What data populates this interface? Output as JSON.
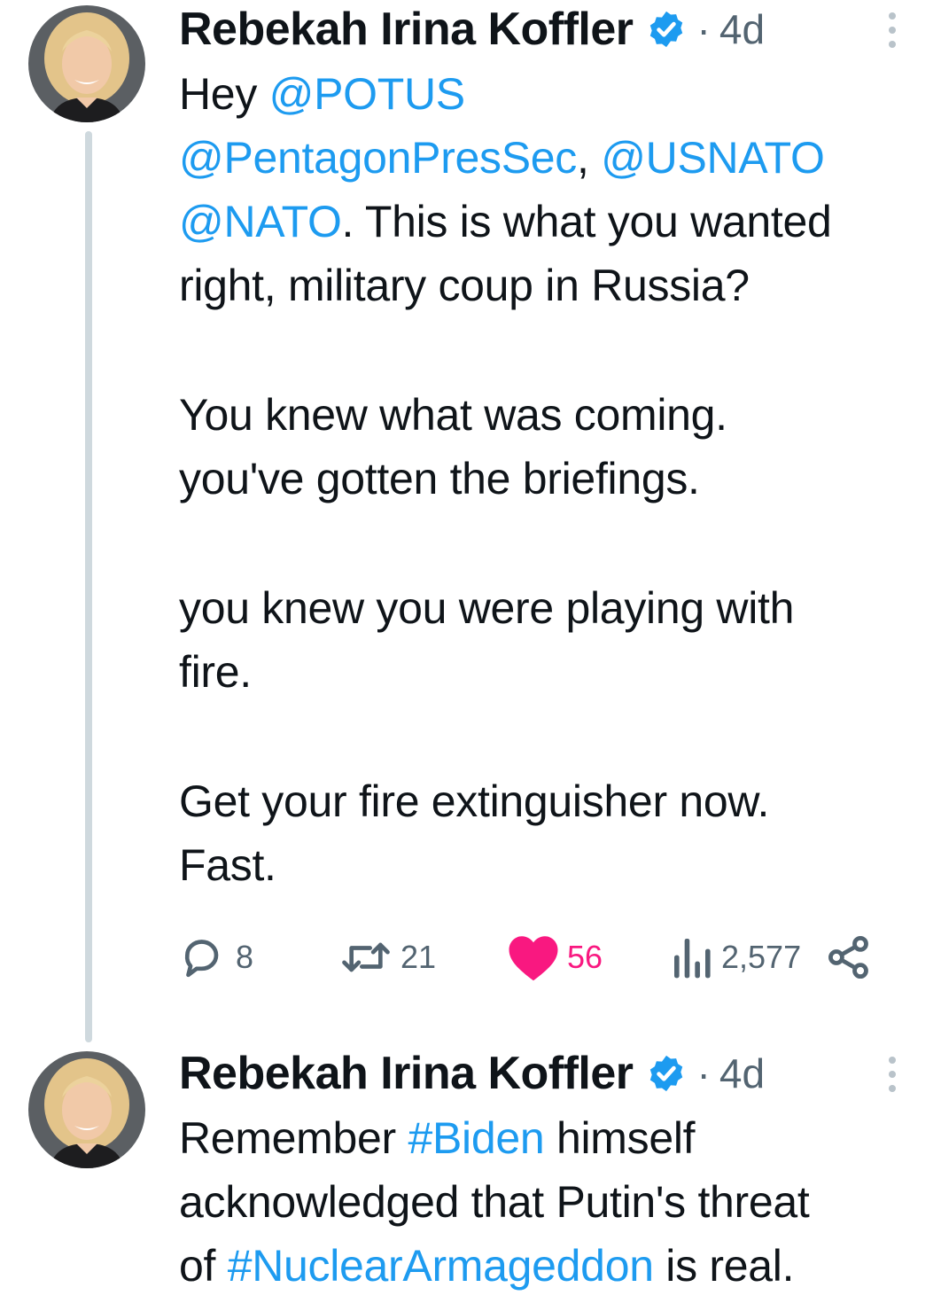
{
  "colors": {
    "link": "#1d9bf0",
    "text": "#0f1419",
    "muted": "#536471",
    "like": "#f91880",
    "verified": "#1d9bf0",
    "thread_line": "#cfd9de"
  },
  "tweets": [
    {
      "author": "Rebekah Irina Koffler",
      "verified": true,
      "separator": "·",
      "time": "4d",
      "lines": [
        [
          {
            "t": "Hey "
          },
          {
            "t": "@POTUS",
            "link": true
          }
        ],
        [
          {
            "t": "@PentagonPresSec",
            "link": true
          },
          {
            "t": ", "
          },
          {
            "t": "@USNATO",
            "link": true
          }
        ],
        [
          {
            "t": "@NATO",
            "link": true
          },
          {
            "t": ". This is what you wanted"
          }
        ],
        [
          {
            "t": "right, military coup in Russia?"
          }
        ],
        null,
        [
          {
            "t": "You knew what was coming."
          }
        ],
        [
          {
            "t": "you've gotten the briefings."
          }
        ],
        null,
        [
          {
            "t": "you knew you were playing with"
          }
        ],
        [
          {
            "t": "fire."
          }
        ],
        null,
        [
          {
            "t": "Get your fire extinguisher now."
          }
        ],
        [
          {
            "t": "Fast."
          }
        ]
      ],
      "actions": {
        "replies": "8",
        "retweets": "21",
        "likes": "56",
        "views": "2,577",
        "liked": true
      }
    },
    {
      "author": "Rebekah Irina Koffler",
      "verified": true,
      "separator": "·",
      "time": "4d",
      "lines": [
        [
          {
            "t": "Remember "
          },
          {
            "t": "#Biden",
            "link": true
          },
          {
            "t": " himself"
          }
        ],
        [
          {
            "t": "acknowledged that Putin's threat"
          }
        ],
        [
          {
            "t": "of "
          },
          {
            "t": "#NuclearArmageddon",
            "link": true
          },
          {
            "t": " is real."
          }
        ]
      ]
    }
  ],
  "icons": {
    "avatar": "avatar-photo",
    "verified": "verified-badge-icon",
    "more": "more-vertical-icon",
    "reply": "reply-icon",
    "retweet": "retweet-icon",
    "like": "heart-icon",
    "views": "views-icon",
    "share": "share-icon"
  }
}
